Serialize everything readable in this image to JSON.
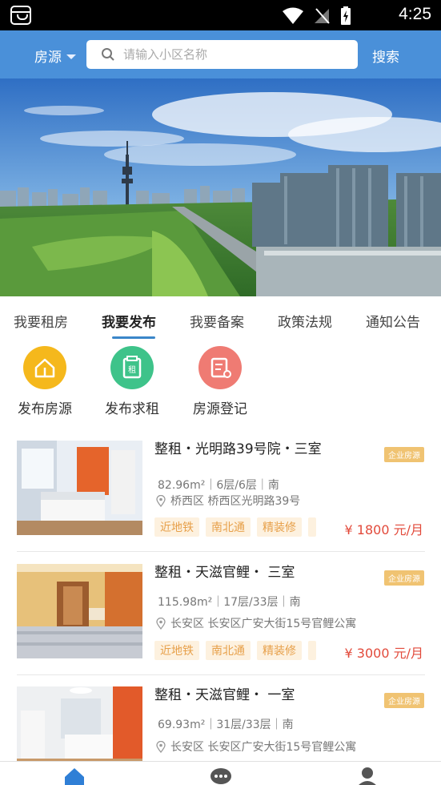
{
  "status_bar": {
    "time": "4:25"
  },
  "header": {
    "house_source_label": "房源",
    "search_placeholder": "请输入小区名称",
    "search_button": "搜索"
  },
  "tabs": [
    {
      "label": "我要租房",
      "active": false
    },
    {
      "label": "我要发布",
      "active": true
    },
    {
      "label": "我要备案",
      "active": false
    },
    {
      "label": "政策法规",
      "active": false
    },
    {
      "label": "通知公告",
      "active": false
    }
  ],
  "quick_actions": [
    {
      "label": "发布房源",
      "icon": "house-publish-icon",
      "color": "#f5b81c"
    },
    {
      "label": "发布求租",
      "icon": "rent-request-icon",
      "color": "#3ec38a"
    },
    {
      "label": "房源登记",
      "icon": "register-icon",
      "color": "#ef7b73"
    }
  ],
  "listings": [
    {
      "title": "整租・光明路39号院・三室",
      "badge": "企业房源",
      "meta": "82.96m²｜6层/6层｜南",
      "address": "桥西区 桥西区光明路39号",
      "tags": [
        "近地铁",
        "南北通",
        "精装修"
      ],
      "price": "¥ 1800",
      "price_unit": "元/月"
    },
    {
      "title": "整租・天滋官鲤・ 三室",
      "badge": "企业房源",
      "meta": "115.98m²｜17层/33层｜南",
      "address": "长安区 长安区广安大街15号官鲤公寓",
      "tags": [
        "近地铁",
        "南北通",
        "精装修"
      ],
      "price": "¥ 3000",
      "price_unit": "元/月"
    },
    {
      "title": "整租・天滋官鲤・ 一室",
      "badge": "企业房源",
      "meta": "69.93m²｜31层/33层｜南",
      "address": "长安区 长安区广安大街15号官鲤公寓",
      "tags": [],
      "price": "",
      "price_unit": ""
    }
  ],
  "colors": {
    "primary": "#4a90d9",
    "price": "#e24a3b",
    "tag_text": "#e7a04a",
    "badge_bg": "#f0c372"
  },
  "bottom_nav": [
    {
      "icon": "home-icon",
      "active": true
    },
    {
      "icon": "message-icon",
      "active": false
    },
    {
      "icon": "profile-icon",
      "active": false
    }
  ]
}
